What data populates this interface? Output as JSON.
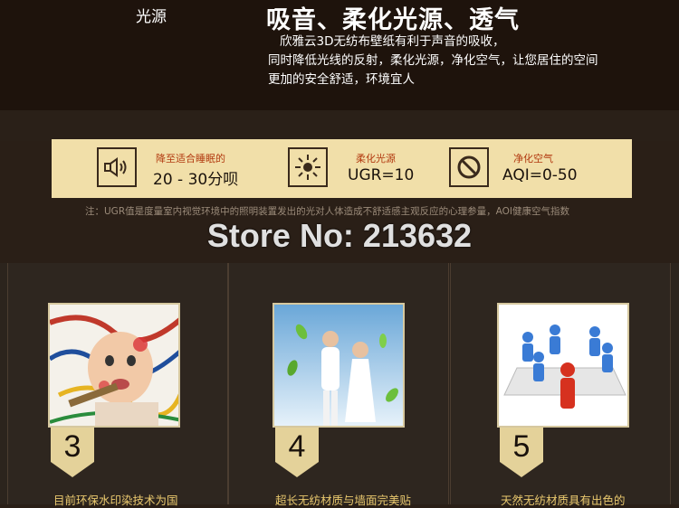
{
  "top": {
    "side_label": "光源",
    "title": "吸音、柔化光源、透气",
    "desc_lines": [
      "欣雅云3D无纺布壁纸有利于声音的吸收，",
      "同时降低光线的反射，柔化光源，净化空气，让您居住的空间",
      "更加的安全舒适，环境宜人"
    ]
  },
  "strip": {
    "items": [
      {
        "caption": "降至适合睡眠的",
        "value": "20 - 30分呗",
        "icon": "speaker-icon"
      },
      {
        "caption": "柔化光源",
        "value": "UGR=10",
        "icon": "sun-icon"
      },
      {
        "caption": "净化空气",
        "value": "AQI=0-50",
        "icon": "prohibited-icon"
      }
    ]
  },
  "note": "注：UGR值是度量室内视觉环境中的照明装置发出的光对人体造成不舒适感主观反应的心理参量，AOI健康空气指数",
  "store": "Store No: 213632",
  "cards": [
    {
      "number": "3",
      "text": "目前环保水印染技术为国"
    },
    {
      "number": "4",
      "text": "超长无纺材质与墙面完美贴"
    },
    {
      "number": "5",
      "text": "天然无纺材质具有出色的"
    }
  ],
  "colors": {
    "strip_bg": "#f1dfa9",
    "accent_text": "#e9c86e",
    "caption_red": "#b23a10"
  }
}
